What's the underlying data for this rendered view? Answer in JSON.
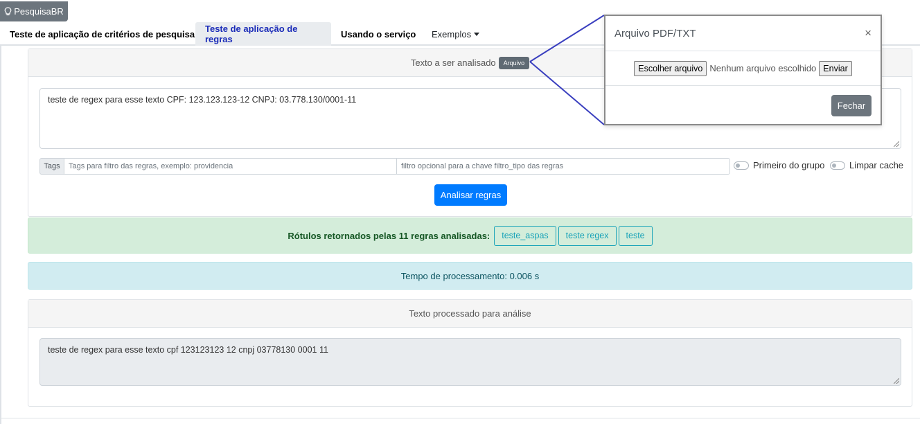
{
  "brand": {
    "label": "PesquisaBR",
    "icon": "lightbulb-icon"
  },
  "tabs": [
    {
      "label": "Teste de aplicação de critérios de pesquisa"
    },
    {
      "label": "Teste de aplicação de regras"
    },
    {
      "label": "Usando o serviço"
    },
    {
      "label": "Exemplos"
    }
  ],
  "input_card": {
    "header": "Texto a ser analisado",
    "arquivo_button": "Arquivo",
    "text": "teste de regex para esse texto  CPF: 123.123.123-12 CNPJ: 03.778.130/0001-11",
    "tags_label": "Tags",
    "tags_placeholder": "Tags para filtro das regras, exemplo: providencia",
    "filter_placeholder": "filtro opcional para a chave filtro_tipo das regras",
    "toggle_primeiro": "Primeiro do grupo",
    "toggle_cache": "Limpar cache",
    "analyze_button": "Analisar regras"
  },
  "results": {
    "label_text": "Rótulos retornados pelas 11 regras analisadas:",
    "chips": [
      "teste_aspas",
      "teste regex",
      "teste"
    ],
    "time_text": "Tempo de processamento: 0.006 s"
  },
  "processed_card": {
    "header": "Texto processado para análise",
    "text": "teste de regex para esse texto cpf 123123123 12 cnpj 03778130 0001 11"
  },
  "modal": {
    "title": "Arquivo PDF/TXT",
    "close": "×",
    "choose_button": "Escolher arquivo",
    "no_file_text": "Nenhum arquivo escolhido",
    "send_button": "Enviar",
    "close_button": "Fechar"
  },
  "colors": {
    "primary": "#007bff",
    "secondary": "#6c757d",
    "success_bg": "#d4edda",
    "info_bg": "#d1ecf1",
    "chip": "#17a2b8",
    "callout": "#3a3fbf"
  }
}
